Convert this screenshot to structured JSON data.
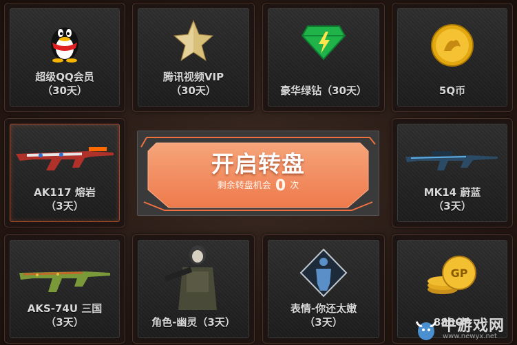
{
  "prizes": [
    {
      "id": "qq-vip",
      "name": "超级QQ会员",
      "duration": "（30天）",
      "icon": "qq-penguin-icon"
    },
    {
      "id": "tencent-video",
      "name": "腾讯视频VIP",
      "duration": "（30天）",
      "icon": "star-icon"
    },
    {
      "id": "green-diamond",
      "name": "豪华绿钻（30天）",
      "duration": "",
      "icon": "green-diamond-icon"
    },
    {
      "id": "q-coin",
      "name": "5Q币",
      "duration": "",
      "icon": "q-coin-icon"
    },
    {
      "id": "ak117",
      "name": "AK117 熔岩",
      "duration": "（3天）",
      "icon": "rifle-icon"
    },
    {
      "id": "mk14",
      "name": "MK14 蔚蓝",
      "duration": "（3天）",
      "icon": "sniper-rifle-icon"
    },
    {
      "id": "aks74u",
      "name": "AKS-74U 三国",
      "duration": "（3天）",
      "icon": "smg-icon"
    },
    {
      "id": "ghost",
      "name": "角色-幽灵（3天）",
      "duration": "",
      "icon": "soldier-icon"
    },
    {
      "id": "emote",
      "name": "表情-你还太嫩",
      "duration": "（3天）",
      "icon": "emote-silhouette-icon"
    },
    {
      "id": "gp",
      "name": "888GP",
      "duration": "",
      "icon": "gp-coins-icon"
    }
  ],
  "spin": {
    "title": "开启转盘",
    "remaining_prefix": "剩余转盘机会",
    "remaining_count": "0",
    "remaining_suffix": "次"
  },
  "watermark": {
    "name": "牛游戏网",
    "url": "www.newyx.net"
  },
  "colors": {
    "button_orange": "#f08a5a",
    "label": "#d8d8d8",
    "frame": "#4a3027"
  }
}
